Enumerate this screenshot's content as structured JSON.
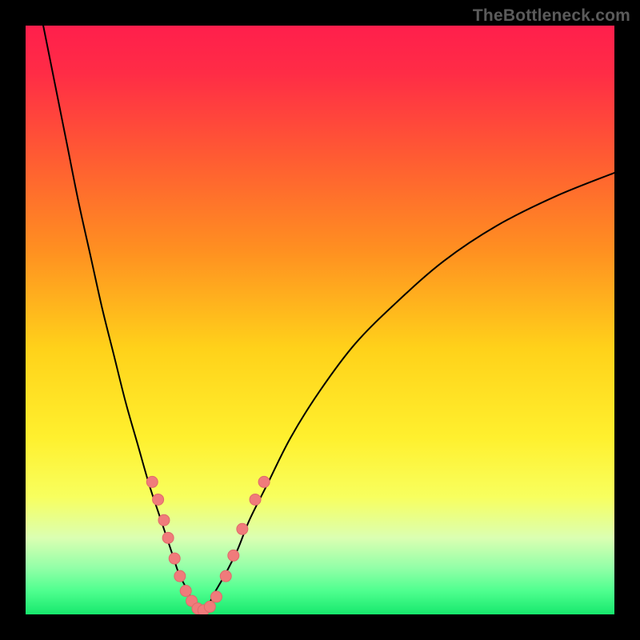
{
  "watermark": "TheBottleneck.com",
  "colors": {
    "frame": "#000000",
    "gradient_stops": [
      {
        "offset": 0.0,
        "color": "#ff1f4c"
      },
      {
        "offset": 0.08,
        "color": "#ff2c46"
      },
      {
        "offset": 0.22,
        "color": "#ff5a33"
      },
      {
        "offset": 0.38,
        "color": "#ff8f21"
      },
      {
        "offset": 0.55,
        "color": "#ffd21a"
      },
      {
        "offset": 0.7,
        "color": "#fff02e"
      },
      {
        "offset": 0.8,
        "color": "#f8ff5e"
      },
      {
        "offset": 0.87,
        "color": "#dbffb2"
      },
      {
        "offset": 0.92,
        "color": "#94ffa8"
      },
      {
        "offset": 0.96,
        "color": "#4fff8f"
      },
      {
        "offset": 1.0,
        "color": "#17e86d"
      }
    ],
    "curve": "#000000",
    "dot_fill": "#f07b7b",
    "dot_stroke": "#e06a6a"
  },
  "chart_data": {
    "type": "line",
    "title": "",
    "xlabel": "",
    "ylabel": "",
    "xlim": [
      0,
      100
    ],
    "ylim": [
      0,
      100
    ],
    "series": [
      {
        "name": "left-branch",
        "x": [
          3,
          5,
          7,
          9,
          11,
          13,
          15,
          17,
          19,
          21,
          23,
          25,
          26,
          27,
          28,
          29,
          30
        ],
        "y": [
          100,
          90,
          80,
          70,
          61,
          52,
          44,
          36,
          29,
          22,
          16,
          10,
          7,
          5,
          3,
          1.5,
          0.5
        ],
        "stroke_width_px": 2
      },
      {
        "name": "right-branch",
        "x": [
          30,
          31,
          32,
          34,
          36,
          38,
          41,
          45,
          50,
          56,
          63,
          71,
          80,
          90,
          100
        ],
        "y": [
          0.5,
          1.5,
          3.5,
          7,
          11,
          16,
          22,
          30,
          38,
          46,
          53,
          60,
          66,
          71,
          75
        ],
        "stroke_width_px": 2
      }
    ],
    "scatter_points": {
      "name": "highlight-dots",
      "points": [
        {
          "x": 21.5,
          "y": 22.5
        },
        {
          "x": 22.5,
          "y": 19.5
        },
        {
          "x": 23.5,
          "y": 16.0
        },
        {
          "x": 24.2,
          "y": 13.0
        },
        {
          "x": 25.3,
          "y": 9.5
        },
        {
          "x": 26.2,
          "y": 6.5
        },
        {
          "x": 27.2,
          "y": 4.0
        },
        {
          "x": 28.2,
          "y": 2.3
        },
        {
          "x": 29.2,
          "y": 1.0
        },
        {
          "x": 30.2,
          "y": 0.7
        },
        {
          "x": 31.3,
          "y": 1.3
        },
        {
          "x": 32.4,
          "y": 3.0
        },
        {
          "x": 34.0,
          "y": 6.5
        },
        {
          "x": 35.3,
          "y": 10.0
        },
        {
          "x": 36.8,
          "y": 14.5
        },
        {
          "x": 39.0,
          "y": 19.5
        },
        {
          "x": 40.5,
          "y": 22.5
        }
      ],
      "radius_px": 7
    }
  }
}
